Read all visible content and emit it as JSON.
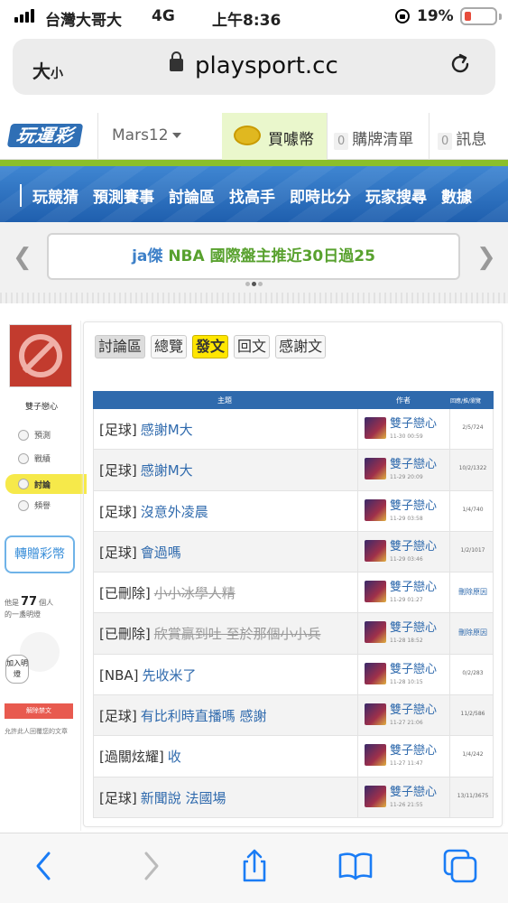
{
  "status": {
    "carrier": "台灣大哥大",
    "network": "4G",
    "time": "上午8:36",
    "battery": "19%"
  },
  "browser": {
    "text_size_big": "大",
    "text_size_small": "小",
    "domain": "playsport.cc"
  },
  "header": {
    "logo": "玩運彩",
    "user": "Mars12",
    "buy": "買噱幣",
    "cart_count": "0",
    "cart": "購牌清單",
    "msg_count": "0",
    "msg": "訊息"
  },
  "nav": [
    "玩競猜",
    "預測賽事",
    "討論區",
    "找高手",
    "即時比分",
    "玩家搜尋",
    "數據"
  ],
  "banner": {
    "who": "ja傑",
    "text": "NBA 國際盤主推近30日過25"
  },
  "sidebar": {
    "name": "雙子戀心",
    "items": [
      "預測",
      "戰績",
      "討論",
      "頻譽"
    ],
    "gift": "轉贈彩幣",
    "likes_pre": "他是",
    "likes_count": "77",
    "likes_post": "個人",
    "likes_line2": "的一盞明燈",
    "join": "加入明燈",
    "unblock": "解除禁文",
    "unblock_note": "允許此人回覆您的文章"
  },
  "crumbs": [
    "討論區",
    "總覽",
    "發文",
    "回文",
    "感謝文"
  ],
  "table": {
    "headers": {
      "title": "主題",
      "author": "作者",
      "stats": "回應/推/瀏覽"
    },
    "rows": [
      {
        "cat": "[足球]",
        "title": "感謝M大",
        "deleted": false,
        "author": "雙子戀心",
        "date": "11-30 00:59",
        "stats": "2/5/724"
      },
      {
        "cat": "[足球]",
        "title": "感謝M大",
        "deleted": false,
        "author": "雙子戀心",
        "date": "11-29 20:09",
        "stats": "10/2/1322"
      },
      {
        "cat": "[足球]",
        "title": "沒意外凌晨",
        "deleted": false,
        "author": "雙子戀心",
        "date": "11-29 03:58",
        "stats": "1/4/740"
      },
      {
        "cat": "[足球]",
        "title": "會過嗎",
        "deleted": false,
        "author": "雙子戀心",
        "date": "11-29 03:46",
        "stats": "1/2/1017"
      },
      {
        "cat": "[已刪除]",
        "title": "小小冰學人精",
        "deleted": true,
        "author": "雙子戀心",
        "date": "11-29 01:27",
        "stats": "刪除原因"
      },
      {
        "cat": "[已刪除]",
        "title": "欣賞贏到吐 至於那個小小兵",
        "deleted": true,
        "author": "雙子戀心",
        "date": "11-28 18:52",
        "stats": "刪除原因"
      },
      {
        "cat": "[NBA]",
        "title": "先收米了",
        "deleted": false,
        "author": "雙子戀心",
        "date": "11-28 10:15",
        "stats": "0/2/283"
      },
      {
        "cat": "[足球]",
        "title": "有比利時直播嗎 感謝",
        "deleted": false,
        "author": "雙子戀心",
        "date": "11-27 21:06",
        "stats": "11/2/586"
      },
      {
        "cat": "[過關炫耀]",
        "title": "收",
        "deleted": false,
        "author": "雙子戀心",
        "date": "11-27 11:47",
        "stats": "1/4/242"
      },
      {
        "cat": "[足球]",
        "title": "新聞說 法國場",
        "deleted": false,
        "author": "雙子戀心",
        "date": "11-26 21:55",
        "stats": "13/11/3675"
      }
    ]
  },
  "colors": {
    "nav_blue": "#2f6aad",
    "accent_yellow": "#ffe600",
    "green": "#8bbf2a",
    "link_blue": "#2f6aad",
    "ios_blue": "#1a7cf5"
  }
}
